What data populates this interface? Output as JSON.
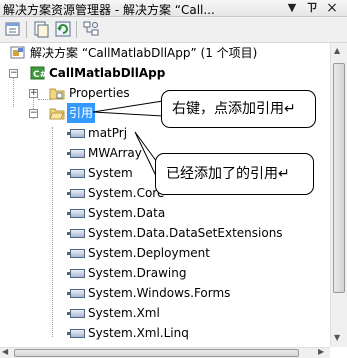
{
  "window": {
    "title": "解决方案资源管理器 - 解决方案 “Call...",
    "dropdown_glyph": "▼",
    "pin_glyph": "ㄗ",
    "close_glyph": "×"
  },
  "toolbar": {
    "buttons": [
      "properties-icon",
      "show-all-files-icon",
      "refresh-icon",
      "class-diagram-icon"
    ]
  },
  "tree": {
    "solution": {
      "label": "解决方案 “CallMatlabDllApp” (1 个项目)",
      "icon": "solution-icon"
    },
    "project": {
      "label": "CallMatlabDllApp",
      "expander": "−",
      "icon": "csharp-project-icon"
    },
    "properties": {
      "label": "Properties",
      "expander": "+",
      "icon": "properties-folder-icon"
    },
    "references": {
      "label": "引用",
      "expander": "−",
      "icon": "references-folder-icon",
      "selected": true
    },
    "reference_items": [
      "matPrj",
      "MWArray",
      "System",
      "System.Core",
      "System.Data",
      "System.Data.DataSetExtensions",
      "System.Deployment",
      "System.Drawing",
      "System.Windows.Forms",
      "System.Xml",
      "System.Xml.Linq"
    ]
  },
  "annotations": {
    "callout_right_click": "右键，点添加引用↵",
    "callout_added": "已经添加了的引用↵"
  },
  "scrollbars": {
    "vertical_up": "▲",
    "vertical_down": "▼",
    "horizontal_left": "◀",
    "horizontal_right": "▶"
  }
}
